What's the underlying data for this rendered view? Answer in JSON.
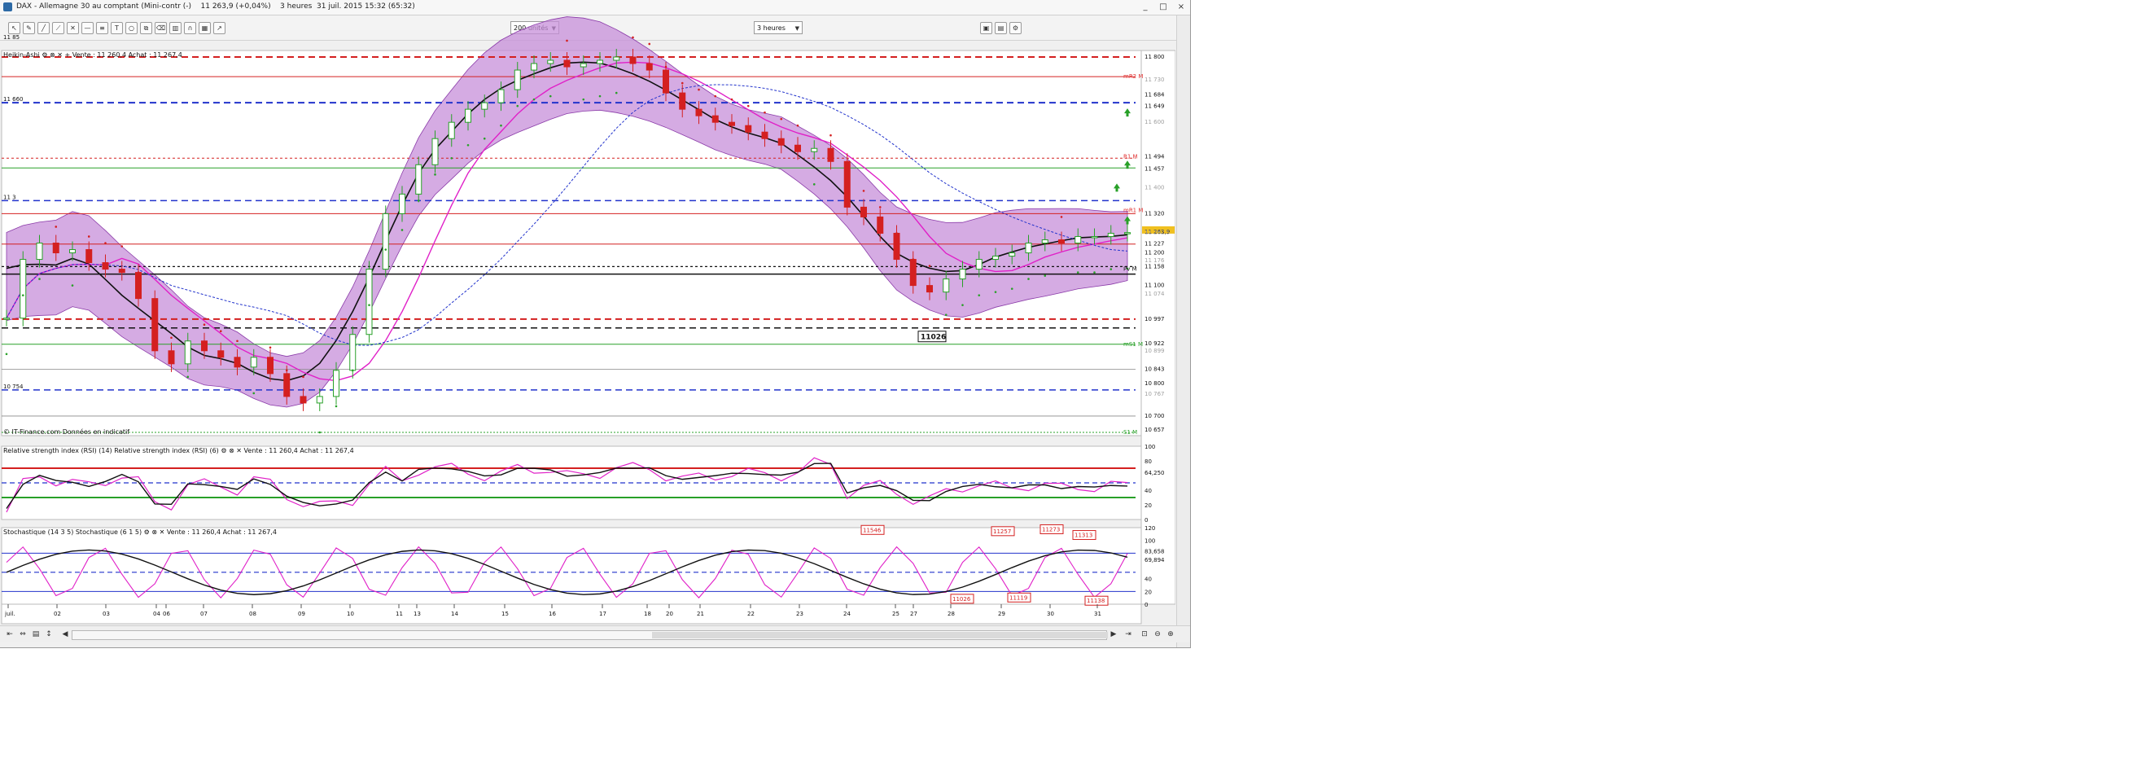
{
  "window": {
    "title": "DAX - Allemagne 30 au comptant (Mini-contr (-)    11 263,9 (+0,04%)    3 heures  31 juil. 2015 15:32 (65:32)",
    "controls": [
      "_",
      "□",
      "×"
    ]
  },
  "toolbar": {
    "units_select": "200 unités",
    "period_select": "3 heures",
    "tools": [
      "pointer-icon",
      "pencil-icon",
      "line-icon",
      "measure-icon",
      "cross-icon",
      "hline-icon",
      "fib-icon",
      "text-icon",
      "ellipse-icon",
      "copy-icon",
      "delete-icon",
      "trash-icon",
      "magnet-icon",
      "grid-icon",
      "arrow-icon"
    ]
  },
  "panels": {
    "price_header": "Heikin-Ashi  ⚙ ⊗ ✕ +  Vente : 11 260,4  Achat : 11 267,4",
    "watermark": "© IT-Finance.com  Données en indicatif",
    "rsi_header": "Relative strength index (RSI) (14) Relative strength index (RSI) (6)  ⚙ ⊗ ✕  Vente : 11 260,4  Achat : 11 267,4",
    "stoch_header": "Stochastique (14 3 5) Stochastique (6 1 5)  ⚙ ⊗ ✕  Vente : 11 260,4  Achat : 11 267,4"
  },
  "chart_data": [
    {
      "type": "line",
      "series": [
        {
          "name": "Heikin-Ashi",
          "values": [
            11000,
            11180,
            11230,
            11200,
            11210,
            11170,
            11150,
            11140,
            11060,
            10900,
            10860,
            10930,
            10900,
            10880,
            10850,
            10880,
            10830,
            10760,
            10740,
            10760,
            10840,
            10950,
            11150,
            11320,
            11380,
            11470,
            11550,
            11600,
            11640,
            11660,
            11700,
            11760,
            11780,
            11790,
            11770,
            11780,
            11790,
            11800,
            11780,
            11760,
            11690,
            11640,
            11620,
            11600,
            11590,
            11570,
            11550,
            11530,
            11510,
            11520,
            11480,
            11340,
            11310,
            11260,
            11180,
            11100,
            11080,
            11120,
            11150,
            11180,
            11190,
            11200,
            11230,
            11240,
            11230,
            11250,
            11250,
            11260,
            11262
          ]
        }
      ],
      "price_axis_ticks": [
        "11 800",
        "11 730",
        "11 684",
        "11 649",
        "11 600",
        "11 494",
        "11 457",
        "11 400",
        "11 320",
        "11 263,9",
        "11 262,5",
        "11 227",
        "11 200",
        "11 176",
        "11 158",
        "11 100",
        "11 074",
        "10 997",
        "10 922",
        "10 899",
        "10 843",
        "10 800",
        "10 767",
        "10 700",
        "10 657"
      ],
      "left_labels": [
        "11 85",
        "11 660",
        "11 3",
        "10 754"
      ],
      "level_labels": [
        {
          "text": "mR2 M",
          "color": "#e03030"
        },
        {
          "text": "R1 M",
          "color": "#e03030"
        },
        {
          "text": "mR1 M",
          "color": "#e03030"
        },
        {
          "text": "Pv M",
          "color": "#111111"
        },
        {
          "text": "mS1 M",
          "color": "#28a028"
        },
        {
          "text": "S1 M",
          "color": "#28a028"
        }
      ],
      "annotation": "11026",
      "x_ticks": [
        "juil.",
        "02",
        "03",
        "04",
        "06",
        "07",
        "08",
        "09",
        "10",
        "11",
        "13",
        "14",
        "15",
        "16",
        "17",
        "18",
        "20",
        "21",
        "22",
        "23",
        "24",
        "25",
        "27",
        "28",
        "29",
        "30",
        "31"
      ]
    },
    {
      "type": "line",
      "title": "Relative strength index (RSI)",
      "ticks": [
        "100",
        "80",
        "64,250",
        "40",
        "20",
        "0"
      ],
      "levels": [
        70,
        30
      ]
    },
    {
      "type": "line",
      "title": "Stochastique",
      "ticks": [
        "120",
        "100",
        "83,658",
        "69,894",
        "40",
        "20",
        "0"
      ],
      "annotations": [
        "11546",
        "11257",
        "11273",
        "11313",
        "11026",
        "11119",
        "11138"
      ]
    }
  ],
  "colors": {
    "bollinger_fill": "#c78fd9",
    "bull_candle": "#28a028",
    "bear_candle": "#d42020",
    "resistance": "#d42020",
    "support_blue": "#2233cc",
    "magenta": "#e020c8",
    "pivot": "#111111"
  }
}
